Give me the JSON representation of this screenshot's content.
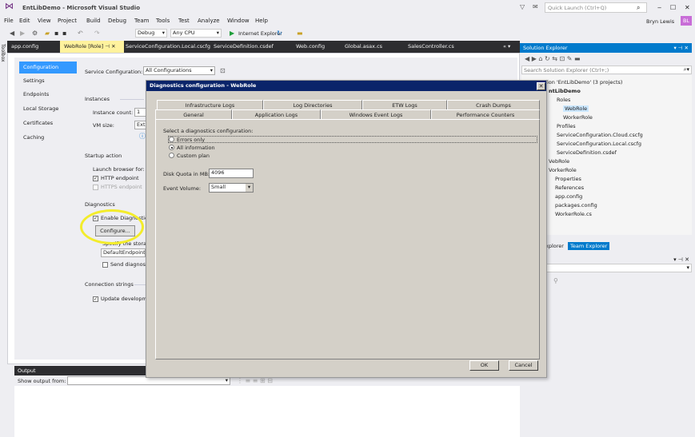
{
  "window": {
    "title": "EntLibDemo - Microsoft Visual Studio",
    "quick_launch_placeholder": "Quick Launch (Ctrl+Q)",
    "user": "Bryn Lewis",
    "user_initials": "BL"
  },
  "menu": [
    "File",
    "Edit",
    "View",
    "Project",
    "Build",
    "Debug",
    "Team",
    "Tools",
    "Test",
    "Analyze",
    "Window",
    "Help"
  ],
  "toolbar": {
    "config": "Debug",
    "platform": "Any CPU",
    "browser": "Internet Explorer"
  },
  "doc_tabs": [
    {
      "label": "app.config",
      "active": false
    },
    {
      "label": "WebRole [Role]",
      "active": true
    },
    {
      "label": "ServiceConfiguration.Local.cscfg",
      "active": false
    },
    {
      "label": "ServiceDefinition.csdef",
      "active": false
    },
    {
      "label": "Web.config",
      "active": false
    },
    {
      "label": "Global.asax.cs",
      "active": false
    },
    {
      "label": "SalesController.cs",
      "active": false
    }
  ],
  "side_toolbox": "Toolbox",
  "role_nav": [
    "Configuration",
    "Settings",
    "Endpoints",
    "Local Storage",
    "Certificates",
    "Caching"
  ],
  "role_config": {
    "service_configuration_label": "Service Configuration:",
    "service_configuration_value": "All Configurations",
    "instances_header": "Instances",
    "instance_count_label": "Instance count:",
    "instance_count_value": "1",
    "vm_size_label": "VM size:",
    "vm_size_value": "Extr",
    "startup_header": "Startup action",
    "launch_browser_label": "Launch browser for:",
    "http_endpoint": "HTTP endpoint",
    "https_endpoint": "HTTPS endpoint",
    "diagnostics_header": "Diagnostics",
    "enable_diagnostics": "Enable Diagnostics",
    "configure_button": "Configure...",
    "specify_storage": "Specify the storage",
    "storage_value": "DefaultEndpointsP",
    "send_diagnostic": "Send diagnostic",
    "connection_header": "Connection strings",
    "update_development": "Update developmer"
  },
  "output": {
    "title": "Output",
    "show_from_label": "Show output from:"
  },
  "solution_explorer": {
    "title": "Solution Explorer",
    "search_placeholder": "Search Solution Explorer (Ctrl+;)",
    "tree": [
      "lon 'EntLibDemo' (3 projects)",
      "ntLibDemo",
      "Roles",
      "WebRole",
      "WorkerRole",
      "Profiles",
      "ServiceConfiguration.Cloud.cscfg",
      "ServiceConfiguration.Local.cscfg",
      "ServiceDefinition.csdef",
      "VebRole",
      "VorkerRole",
      "Properties",
      "References",
      "app.config",
      "packages.config",
      "WorkerRole.cs"
    ],
    "bottom_tabs": [
      "xplorer",
      "Team Explorer"
    ]
  },
  "dialog": {
    "title": "Diagnostics configuration - WebRole",
    "tabs_row1": [
      "Infrastructure Logs",
      "Log Directories",
      "ETW Logs",
      "Crash Dumps"
    ],
    "tabs_row2": [
      "General",
      "Application Logs",
      "Windows Event Logs",
      "Performance Counters"
    ],
    "select_label": "Select a diagnostics configuration:",
    "options": [
      "Errors only",
      "All information",
      "Custom plan"
    ],
    "selected_option": "All information",
    "quota_label": "Disk Quota in MB:",
    "quota_value": "4096",
    "event_volume_label": "Event Volume:",
    "event_volume_value": "Small",
    "ok": "OK",
    "cancel": "Cancel"
  },
  "colors": {
    "accent": "#007acc",
    "selection": "#3399ff",
    "dialog_title": "#0a246a",
    "highlight_circle": "#f3ec2b"
  }
}
